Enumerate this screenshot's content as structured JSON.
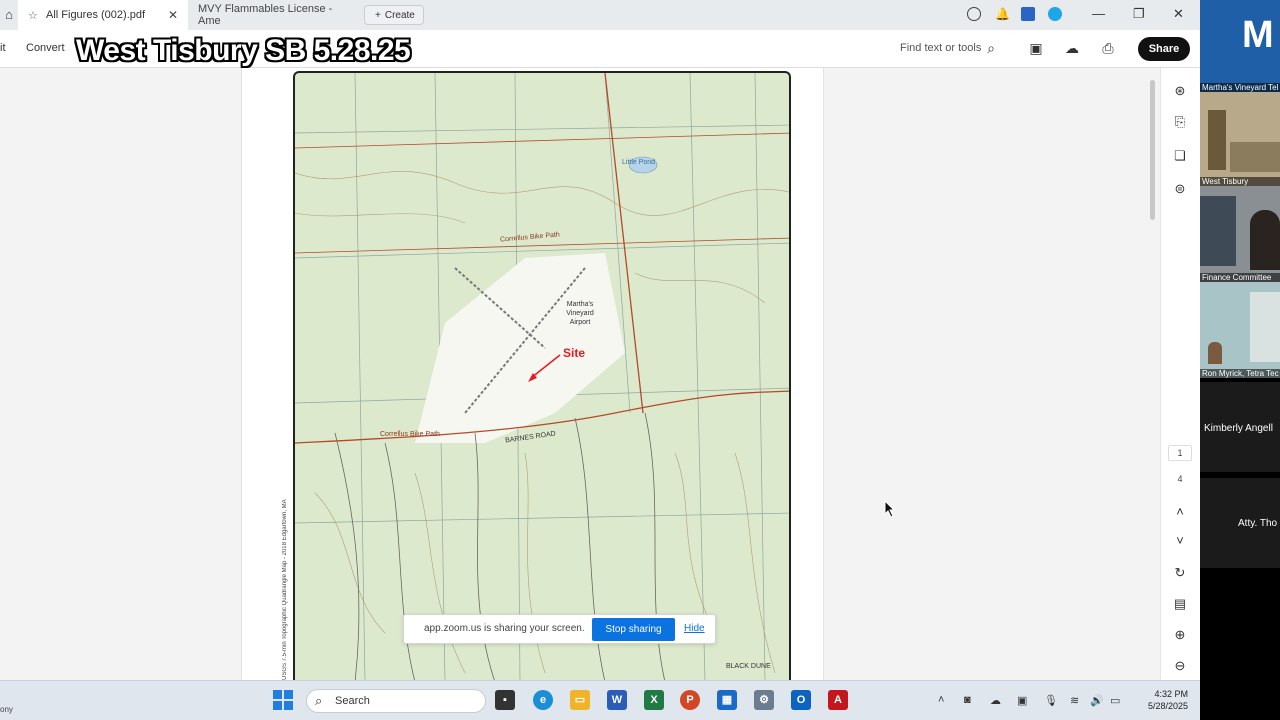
{
  "browser": {
    "tabs": [
      {
        "label": "All Figures (002).pdf",
        "active": true
      },
      {
        "label": "MVY Flammables License - Ame",
        "active": false
      }
    ],
    "create_label": "Create"
  },
  "toolbar": {
    "left_cut": "it",
    "convert_label": "Convert",
    "overlay_title": "West Tisbury SB 5.28.25",
    "find_label": "Find text or tools",
    "share_label": "Share"
  },
  "map": {
    "labels": {
      "pond": "Little Pond",
      "airport": "Martha's Vineyard Airport",
      "site": "Site",
      "road": "BARNES ROAD",
      "bike1": "Correllus Bike Path",
      "bike2": "Correllus Bike Path",
      "dune": "BLACK DUNE"
    },
    "side_caption": "USGS 7.5-min Topographic Quadrangle Map - 2018 Edgartown, MA"
  },
  "viewer": {
    "page_current": "1",
    "page_total": "4"
  },
  "zoom_banner": {
    "message": "app.zoom.us is sharing your screen.",
    "stop_label": "Stop sharing",
    "hide_label": "Hide"
  },
  "taskbar": {
    "left_text": "ony",
    "search_label": "Search",
    "time": "4:32 PM",
    "date": "5/28/2025"
  },
  "participants": [
    {
      "name": "Martha's Vineyard Tel"
    },
    {
      "name": "West Tisbury"
    },
    {
      "name": "Finance Committee"
    },
    {
      "name": "Ron Myrick, Tetra Tec"
    },
    {
      "name": "Kimberly Angell"
    },
    {
      "name": "Atty. Tho"
    }
  ],
  "colors": {
    "accent": "#0a73e0",
    "site_red": "#e41b23",
    "map_bg": "#dde9cd"
  }
}
